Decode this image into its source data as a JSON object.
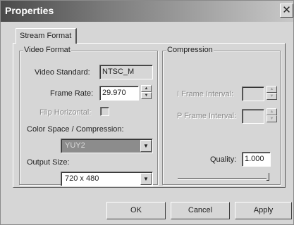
{
  "window": {
    "title": "Properties",
    "close_glyph": "✕"
  },
  "tab": {
    "label": "Stream Format"
  },
  "video_format": {
    "group_label": "Video Format",
    "standard_label": "Video Standard:",
    "standard_value": "NTSC_M",
    "frame_rate_label": "Frame Rate:",
    "frame_rate_value": "29.970",
    "flip_label": "Flip Horizontal:",
    "flip_checked": false,
    "color_space_label": "Color Space / Compression:",
    "color_space_value": "YUY2",
    "output_size_label": "Output Size:",
    "output_size_value": "720 x 480"
  },
  "compression": {
    "group_label": "Compression",
    "i_frame_label": "I Frame Interval:",
    "i_frame_value": "",
    "p_frame_label": "P Frame Interval:",
    "p_frame_value": "",
    "quality_label": "Quality:",
    "quality_value": "1.000",
    "quality_slider_level": 1.0
  },
  "buttons": {
    "ok": "OK",
    "cancel": "Cancel",
    "apply": "Apply"
  },
  "icons": {
    "spin_up": "up-arrow-icon",
    "spin_down": "down-arrow-icon",
    "dropdown": "chevron-down-icon"
  },
  "colors": {
    "title_dark": "#4a4a4a",
    "title_light": "#c8c8c8",
    "face": "#d6d6d6",
    "disabled_combo": "#8c8c8c"
  }
}
